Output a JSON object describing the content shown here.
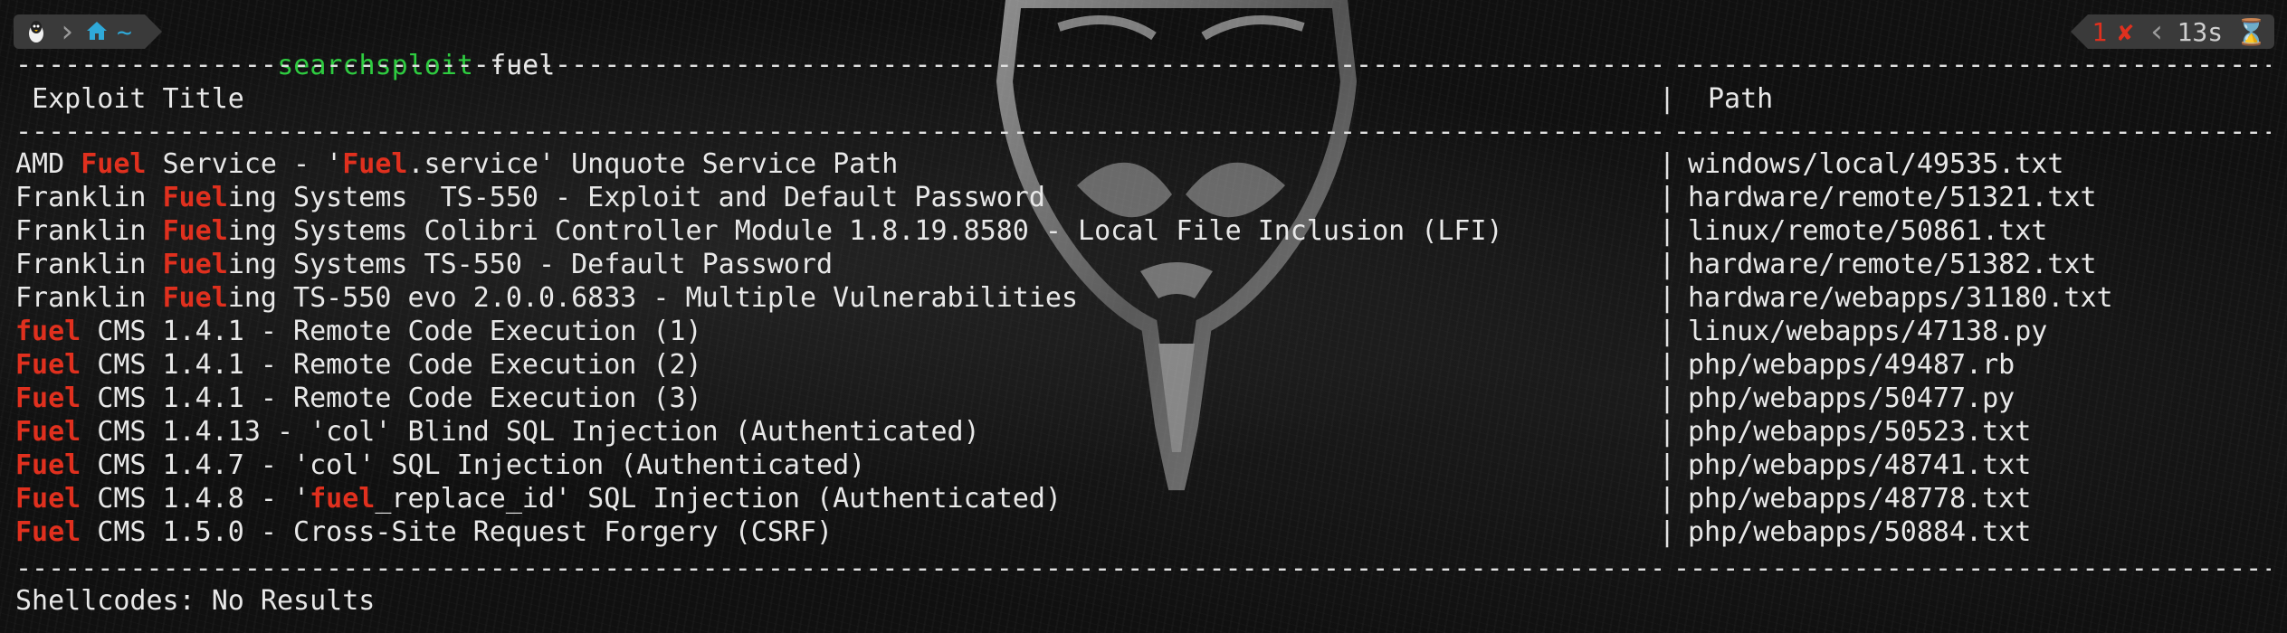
{
  "prompt": {
    "os_icon": "linux-penguin-icon",
    "home_icon": "home-icon",
    "directory": "~",
    "command": "searchsploit",
    "argument": "fuel",
    "exit_status": "1",
    "status_icon": "x-icon",
    "duration": "13s",
    "duration_icon": "hourglass-icon"
  },
  "table": {
    "header_title": "Exploit Title",
    "header_path": "Path",
    "separator": "|",
    "rows": [
      {
        "pre": "AMD ",
        "hl": "Fuel",
        "mid": " Service - '",
        "hl2": "Fuel",
        "post": ".service' Unquote Service Path",
        "path": "windows/local/49535.txt"
      },
      {
        "pre": "Franklin ",
        "hl": "Fuel",
        "mid": "",
        "hl2": "",
        "post": "ing Systems  TS-550 - Exploit and Default Password",
        "path": "hardware/remote/51321.txt"
      },
      {
        "pre": "Franklin ",
        "hl": "Fuel",
        "mid": "",
        "hl2": "",
        "post": "ing Systems Colibri Controller Module 1.8.19.8580 - Local File Inclusion (LFI)",
        "path": "linux/remote/50861.txt"
      },
      {
        "pre": "Franklin ",
        "hl": "Fuel",
        "mid": "",
        "hl2": "",
        "post": "ing Systems TS-550 - Default Password",
        "path": "hardware/remote/51382.txt"
      },
      {
        "pre": "Franklin ",
        "hl": "Fuel",
        "mid": "",
        "hl2": "",
        "post": "ing TS-550 evo 2.0.0.6833 - Multiple Vulnerabilities",
        "path": "hardware/webapps/31180.txt"
      },
      {
        "pre": "",
        "hl": "fuel",
        "mid": "",
        "hl2": "",
        "post": " CMS 1.4.1 - Remote Code Execution (1)",
        "path": "linux/webapps/47138.py"
      },
      {
        "pre": "",
        "hl": "Fuel",
        "mid": "",
        "hl2": "",
        "post": " CMS 1.4.1 - Remote Code Execution (2)",
        "path": "php/webapps/49487.rb"
      },
      {
        "pre": "",
        "hl": "Fuel",
        "mid": "",
        "hl2": "",
        "post": " CMS 1.4.1 - Remote Code Execution (3)",
        "path": "php/webapps/50477.py"
      },
      {
        "pre": "",
        "hl": "Fuel",
        "mid": "",
        "hl2": "",
        "post": " CMS 1.4.13 - 'col' Blind SQL Injection (Authenticated)",
        "path": "php/webapps/50523.txt"
      },
      {
        "pre": "",
        "hl": "Fuel",
        "mid": "",
        "hl2": "",
        "post": " CMS 1.4.7 - 'col' SQL Injection (Authenticated)",
        "path": "php/webapps/48741.txt"
      },
      {
        "pre": "",
        "hl": "Fuel",
        "mid": " CMS 1.4.8 - '",
        "hl2": "fuel",
        "post": "_replace_id' SQL Injection (Authenticated)",
        "path": "php/webapps/48778.txt"
      },
      {
        "pre": "",
        "hl": "Fuel",
        "mid": "",
        "hl2": "",
        "post": " CMS 1.5.0 - Cross-Site Request Forgery (CSRF)",
        "path": "php/webapps/50884.txt"
      }
    ]
  },
  "shellcodes_line": "Shellcodes: No Results",
  "colors": {
    "highlight": "#e0301e",
    "command": "#2ecc40",
    "directory": "#2fa9d8",
    "segment_bg": "#3a3a3a"
  }
}
